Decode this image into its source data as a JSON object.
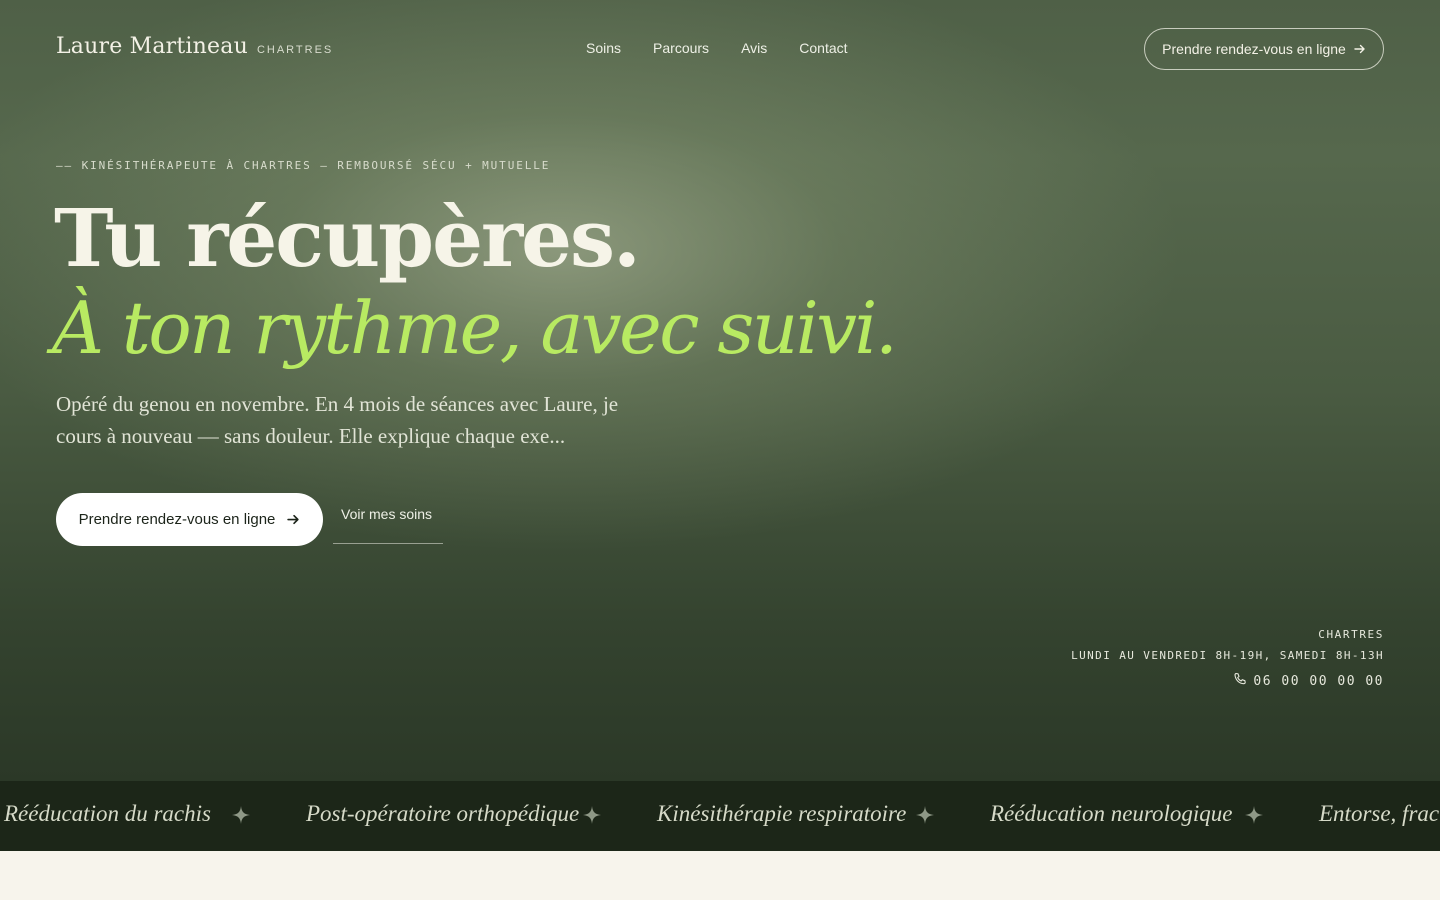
{
  "brand": {
    "name": "Laure Martineau",
    "city": "CHARTRES"
  },
  "nav": {
    "items": [
      "Soins",
      "Parcours",
      "Avis",
      "Contact"
    ]
  },
  "header": {
    "cta_label": "Prendre rendez-vous en ligne"
  },
  "hero": {
    "eyebrow": "—— KINÉSITHÉRAPEUTE À CHARTRES — REMBOURSÉ SÉCU + MUTUELLE",
    "headline_line1": "Tu récupères.",
    "headline_line2": "À ton rythme, avec suivi.",
    "lead": "Opéré du genou en novembre. En 4 mois de séances avec Laure, je cours à nouveau — sans douleur. Elle explique chaque exe...",
    "primary_cta": "Prendre rendez-vous en ligne",
    "secondary_cta": "Voir mes soins"
  },
  "contact": {
    "city": "CHARTRES",
    "hours": "LUNDI AU VENDREDI 8H-19H, SAMEDI 8H-13H",
    "phone": "06 00 00 00 00"
  },
  "marquee": {
    "items": [
      "Rééducation du rachis",
      "Post-opératoire orthopédique",
      "Kinésithérapie respiratoire",
      "Rééducation neurologique",
      "Entorse, fractur"
    ]
  },
  "colors": {
    "accent": "#b8ea62",
    "hero_bg": "#4f6047",
    "marquee_bg": "#1c2618",
    "page_bg": "#f7f4ec"
  },
  "icons": [
    "arrow-right-icon",
    "phone-icon",
    "sparkle-icon"
  ]
}
